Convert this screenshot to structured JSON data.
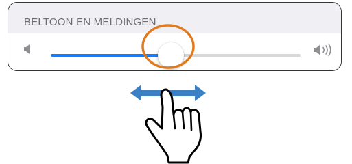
{
  "settings_group": {
    "title": "BELTOON EN MELDINGEN"
  },
  "volume_slider": {
    "value_fraction": 0.48,
    "low_icon": "speaker-low-icon",
    "high_icon": "speaker-high-icon",
    "fill_color": "#1a7cf5",
    "track_color": "#d8d8db"
  },
  "annotation": {
    "highlight_color": "#e07a1f",
    "arrow_color": "#3b7fc4",
    "arrow_icon": "double-arrow-horizontal-icon",
    "hand_icon": "pointing-hand-icon"
  }
}
